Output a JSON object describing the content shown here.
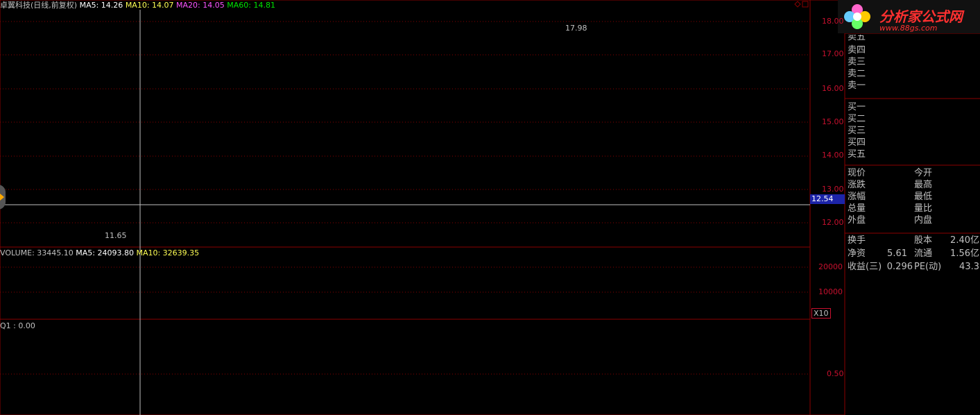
{
  "header": {
    "title": "卓翼科技(日线,前复权)",
    "ma5": "MA5: 14.26",
    "ma10": "MA10: 14.07",
    "ma20": "MA20: 14.05",
    "ma60": "MA60: 14.81",
    "hi_label": "17.98",
    "lo_label": "11.65"
  },
  "volume_header": {
    "volume": "VOLUME: 33445.10",
    "ma5": "MA5: 24093.80",
    "ma10": "MA10: 32639.35"
  },
  "indicator_header": "Q1 : 0.00",
  "price_axis": [
    "18.00",
    "17.00",
    "16.00",
    "15.00",
    "14.00",
    "13.00",
    "12.00"
  ],
  "current_price_tag": "12.54",
  "volume_axis": [
    "20000",
    "10000"
  ],
  "volume_unit": "X10",
  "indicator_axis": [
    "0.50"
  ],
  "logo": {
    "text": "分析家公式网",
    "url": "www.88gs.com"
  },
  "orderbook": {
    "sell": [
      "卖五",
      "卖四",
      "卖三",
      "卖二",
      "卖一"
    ],
    "buy": [
      "买一",
      "买二",
      "买三",
      "买四",
      "买五"
    ]
  },
  "quote": {
    "left": [
      "现价",
      "涨跌",
      "涨幅",
      "总量",
      "外盘"
    ],
    "right": [
      "今开",
      "最高",
      "最低",
      "量比",
      "内盘"
    ]
  },
  "stats": [
    {
      "l1": "换手",
      "v1": "",
      "l2": "股本",
      "v2": "2.40亿"
    },
    {
      "l1": "净资",
      "v1": "5.61",
      "l2": "流通",
      "v2": "1.56亿"
    },
    {
      "l1": "收益(三)",
      "v1": "0.296",
      "l2": "PE(动)",
      "v2": "43.3"
    }
  ],
  "colors": {
    "up": "#ff3a3a",
    "down": "#54ffff",
    "ma5": "#ffffff",
    "ma10": "#ffff54",
    "ma20": "#ff54ff",
    "ma60": "#00e600",
    "grid": "#8b0000"
  }
}
